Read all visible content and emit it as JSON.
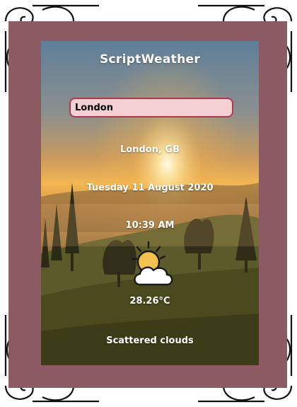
{
  "app": {
    "title": "ScriptWeather"
  },
  "search": {
    "value": "London",
    "placeholder": ""
  },
  "weather": {
    "location": "London, GB",
    "date": "Tuesday 11 August 2020",
    "time": "10:39 AM",
    "icon": "partly-cloudy-icon",
    "temperature": "28.26°C",
    "description": "Scattered clouds"
  },
  "colors": {
    "frame_mat": "#8c5a63",
    "search_bg": "#f4cfd3",
    "search_border": "#b03a4c",
    "text": "#ffffff"
  }
}
